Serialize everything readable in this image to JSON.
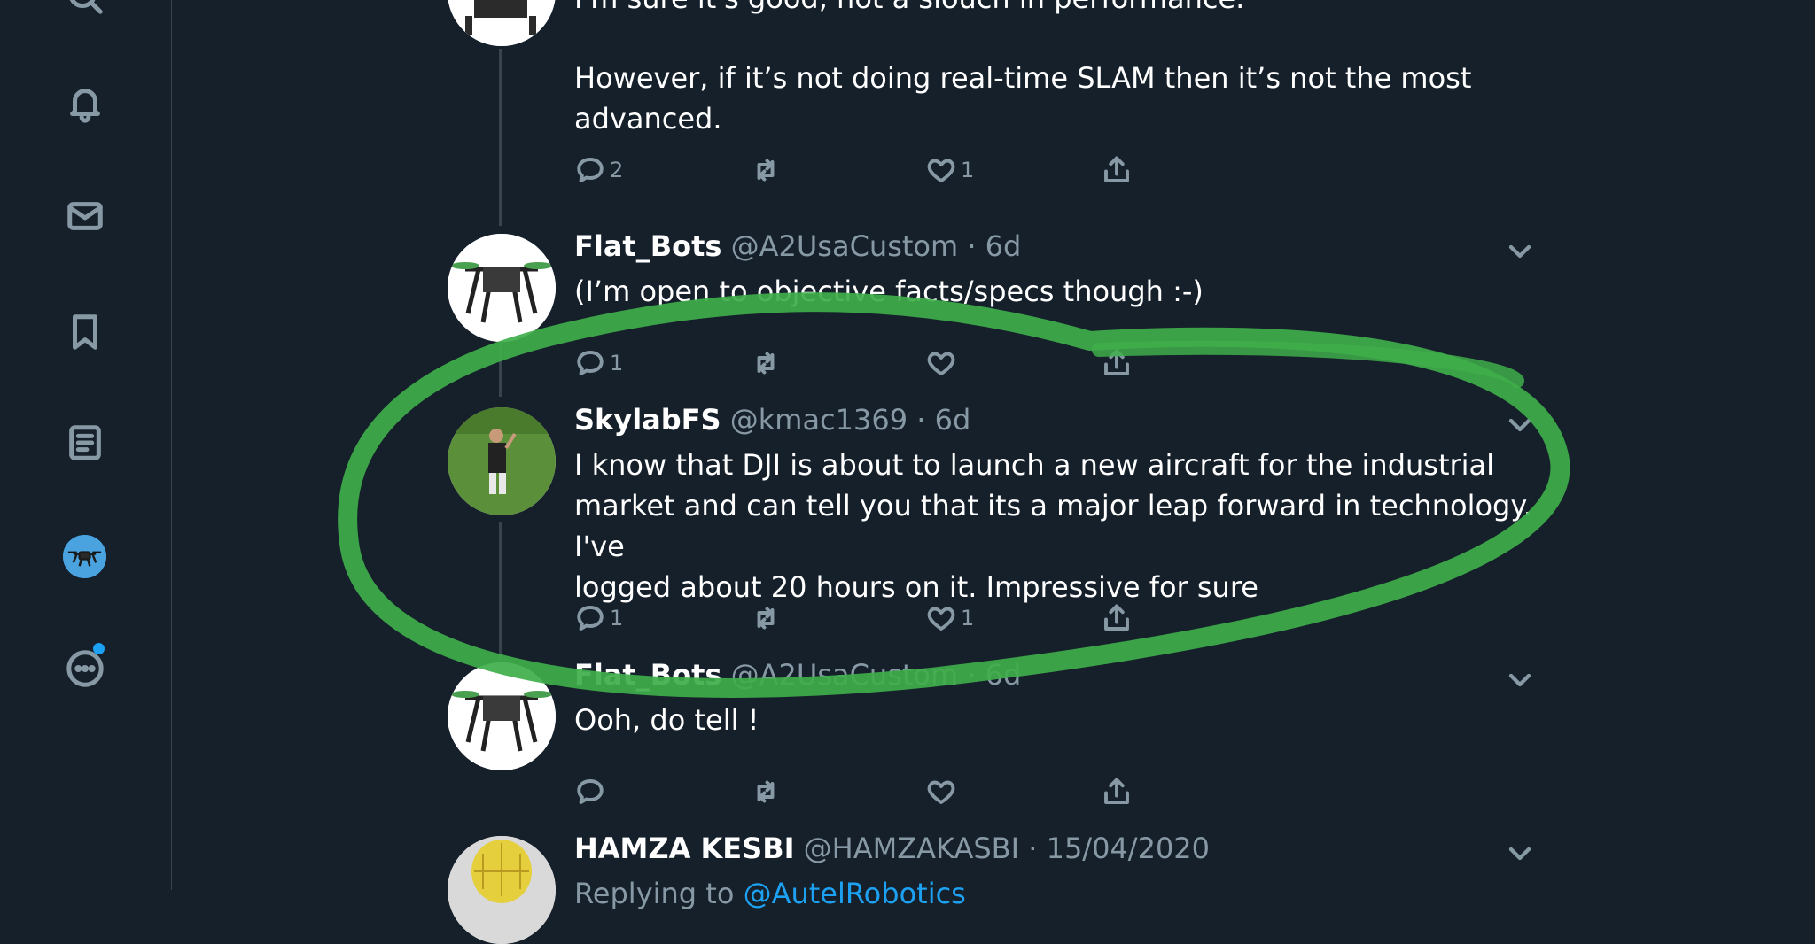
{
  "nav": {
    "icons": [
      "search-icon",
      "bell-icon",
      "mail-icon",
      "bookmark-icon",
      "lists-icon",
      "profile-avatar",
      "more-icon"
    ]
  },
  "colors": {
    "background": "#15202b",
    "secondary_text": "#8899a6",
    "accent": "#1da1f2",
    "annotation_green": "#3fae4a"
  },
  "tweets": [
    {
      "body_top_cut": "I'm sure it's good, not a slouch in performance.",
      "body_lines": [
        "However,  if it’s not doing real-time SLAM then it’s not the most",
        "advanced."
      ],
      "reply_count": "2",
      "retweet_count": "",
      "like_count": "1"
    },
    {
      "name": "Flat_Bots",
      "handle": "@A2UsaCustom",
      "separator": "·",
      "time": "6d",
      "body": "(I’m open to objective facts/specs though :-)",
      "reply_count": "1",
      "retweet_count": "",
      "like_count": ""
    },
    {
      "name": "SkylabFS",
      "handle": "@kmac1369",
      "separator": "·",
      "time": "6d",
      "body_lines": [
        "I know that DJI is about to launch a new aircraft for the industrial",
        "market and can tell you that its a major leap forward in technology. I've",
        "logged about 20 hours on it. Impressive for sure"
      ],
      "reply_count": "1",
      "retweet_count": "",
      "like_count": "1"
    },
    {
      "name": "Flat_Bots",
      "handle": "@A2UsaCustom",
      "separator": "·",
      "time": "6d",
      "body": "Ooh, do tell !",
      "reply_count": "",
      "retweet_count": "",
      "like_count": ""
    },
    {
      "name": "HAMZA KESBI",
      "handle": "@HAMZAKASBI",
      "separator": "·",
      "time": "15/04/2020",
      "replying_prefix": "Replying to",
      "replying_to": "@AutelRobotics"
    }
  ]
}
